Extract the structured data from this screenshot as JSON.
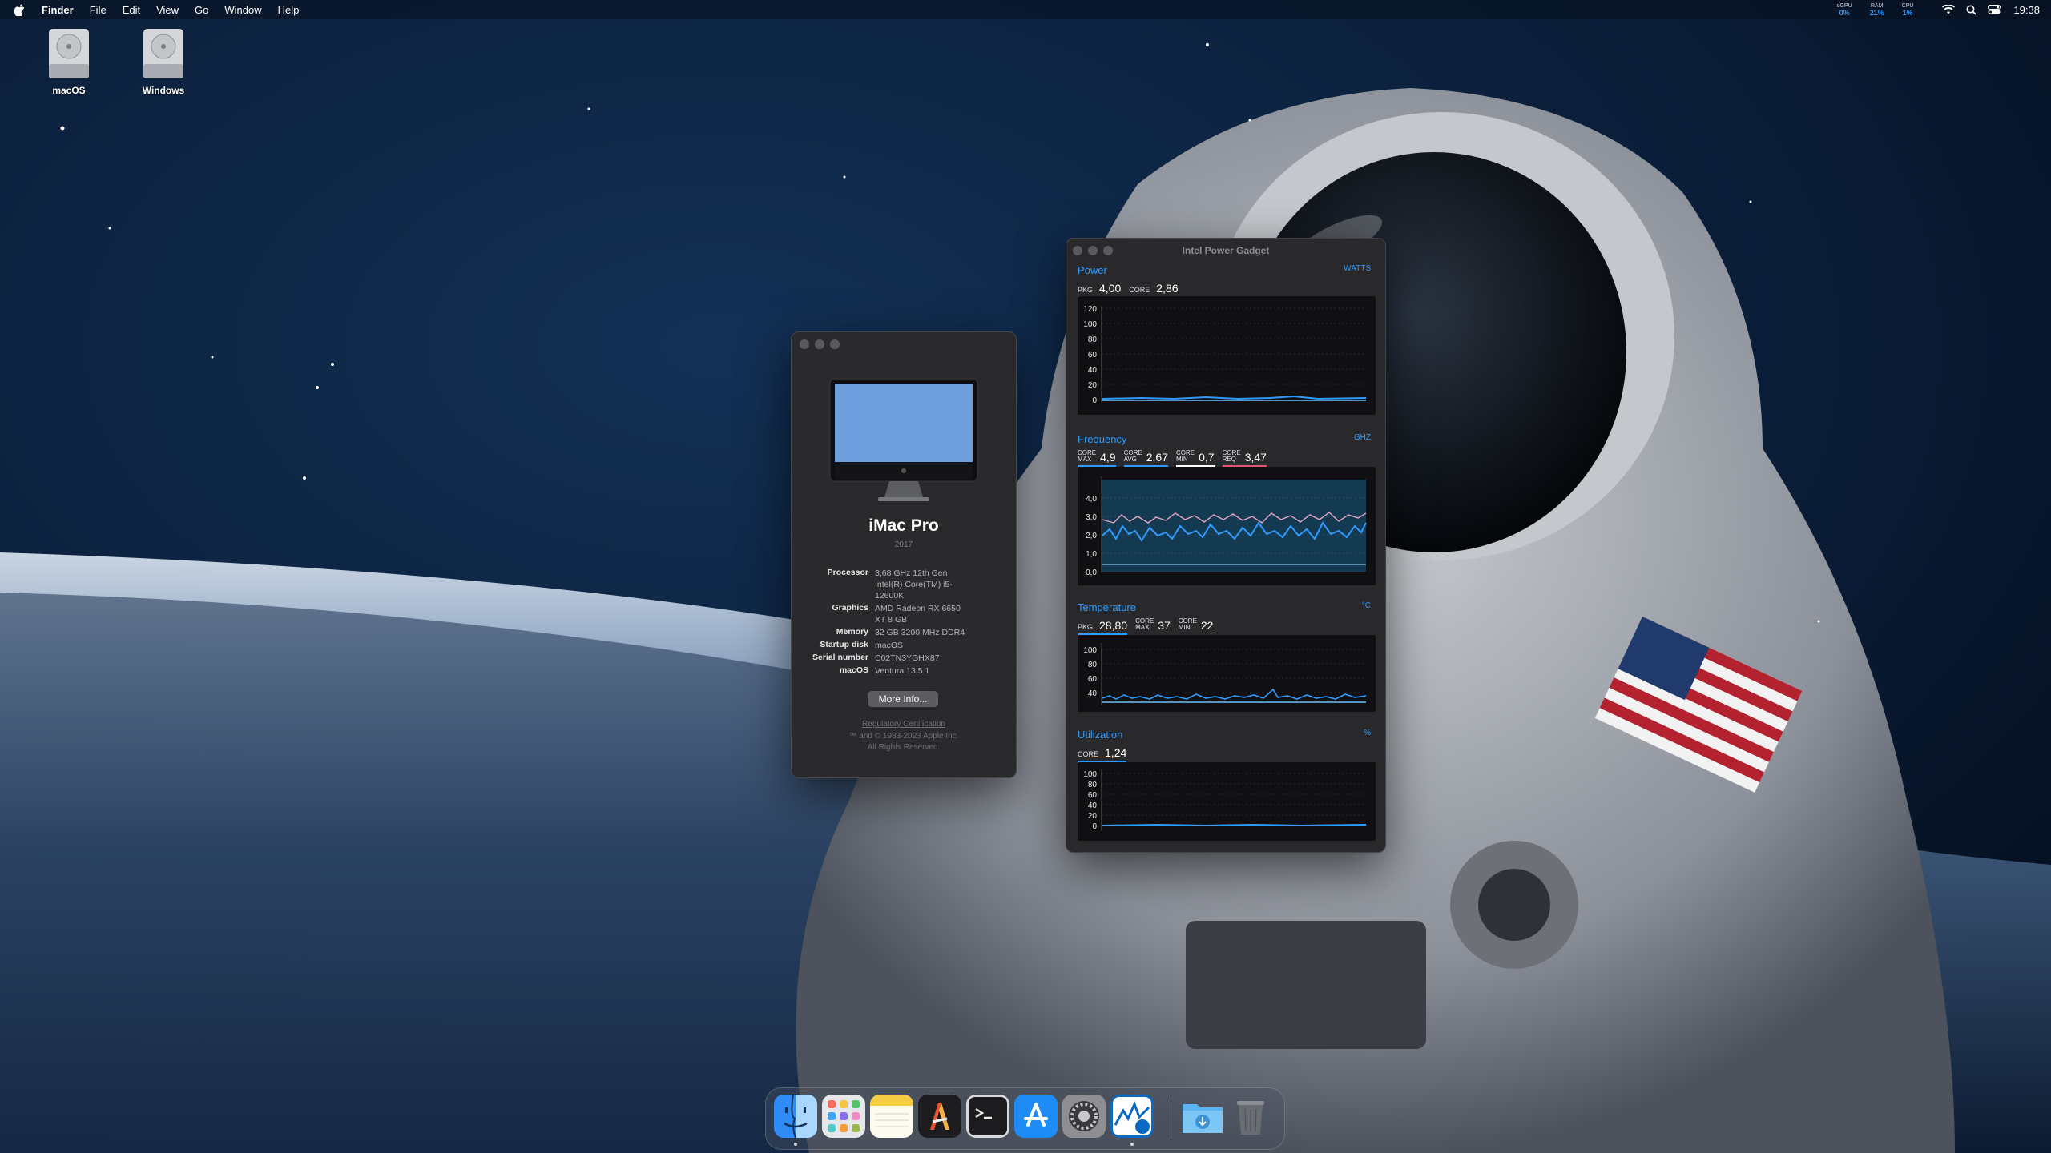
{
  "menubar": {
    "app_name": "Finder",
    "items": [
      "File",
      "Edit",
      "View",
      "Go",
      "Window",
      "Help"
    ],
    "stats": [
      {
        "label": "dGPU",
        "value": "0%"
      },
      {
        "label": "RAM",
        "value": "21%"
      },
      {
        "label": "CPU",
        "value": "1%"
      }
    ],
    "clock": "19:38"
  },
  "desktop": {
    "icons": [
      {
        "label": "macOS"
      },
      {
        "label": "Windows"
      }
    ]
  },
  "about": {
    "model": "iMac Pro",
    "year": "2017",
    "specs": [
      {
        "key": "Processor",
        "value": "3,68 GHz 12th Gen Intel(R) Core(TM) i5-12600K"
      },
      {
        "key": "Graphics",
        "value": "AMD Radeon RX 6650 XT 8 GB"
      },
      {
        "key": "Memory",
        "value": "32 GB 3200 MHz DDR4"
      },
      {
        "key": "Startup disk",
        "value": "macOS"
      },
      {
        "key": "Serial number",
        "value": "C02TN3YGHX87"
      },
      {
        "key": "macOS",
        "value": "Ventura 13.5.1"
      }
    ],
    "more_info_label": "More Info...",
    "regulatory": "Regulatory Certification",
    "copyright": "™ and © 1983-2023 Apple Inc.",
    "rights": "All Rights Reserved."
  },
  "ipg": {
    "title": "Intel Power Gadget",
    "accent": "#2f9bff",
    "power": {
      "heading": "Power",
      "unit": "WATTS",
      "readouts": [
        {
          "label": "PKG",
          "value": "4,00"
        },
        {
          "label": "CORE",
          "value": "2,86"
        }
      ],
      "y_ticks": [
        "120",
        "100",
        "80",
        "60",
        "40",
        "20",
        "0"
      ]
    },
    "frequency": {
      "heading": "Frequency",
      "unit": "GHZ",
      "readouts": [
        {
          "label_top": "CORE",
          "label_bottom": "MAX",
          "value": "4,9"
        },
        {
          "label_top": "CORE",
          "label_bottom": "AVG",
          "value": "2,67"
        },
        {
          "label_top": "CORE",
          "label_bottom": "MIN",
          "value": "0,7"
        },
        {
          "label_top": "CORE",
          "label_bottom": "REQ",
          "value": "3,47"
        }
      ],
      "y_ticks": [
        "4,0",
        "3,0",
        "2,0",
        "1,0",
        "0,0"
      ]
    },
    "temperature": {
      "heading": "Temperature",
      "unit": "°C",
      "readouts": [
        {
          "label": "PKG",
          "value": "28,80"
        },
        {
          "label_top": "CORE",
          "label_bottom": "MAX",
          "value": "37"
        },
        {
          "label_top": "CORE",
          "label_bottom": "MIN",
          "value": "22"
        }
      ],
      "y_ticks": [
        "100",
        "80",
        "60",
        "40"
      ]
    },
    "utilization": {
      "heading": "Utilization",
      "unit": "%",
      "readouts": [
        {
          "label": "CORE",
          "value": "1,24"
        }
      ],
      "y_ticks": [
        "100",
        "80",
        "60",
        "40",
        "20",
        "0"
      ]
    }
  },
  "dock": {
    "apps": [
      "finder-icon",
      "launchpad-icon",
      "notes-icon",
      "ai-app-icon",
      "terminal-icon",
      "app-store-icon",
      "system-settings-icon",
      "intel-power-gadget-icon",
      "downloads-folder-icon",
      "trash-icon"
    ]
  }
}
